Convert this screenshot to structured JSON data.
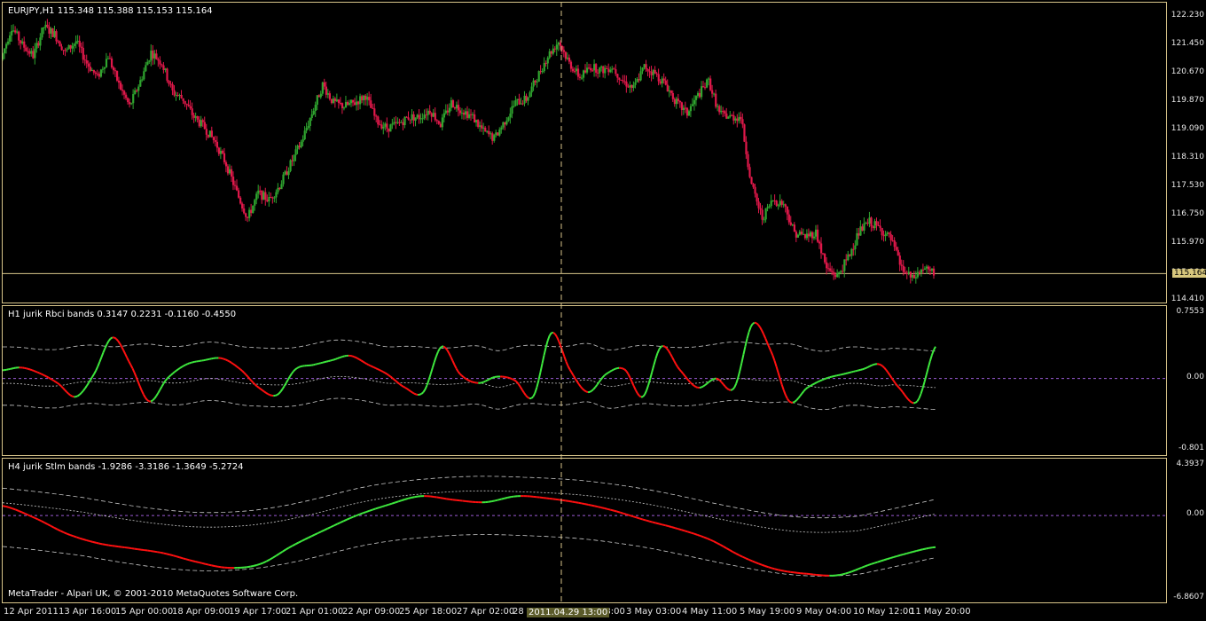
{
  "panes": {
    "main": {
      "title": "EURJPY,H1  115.348 115.388 115.153 115.164",
      "scale": [
        "122.230",
        "121.450",
        "120.670",
        "119.870",
        "119.090",
        "118.310",
        "117.530",
        "116.750",
        "115.970",
        "115.164",
        "114.410"
      ],
      "last": "115.164"
    },
    "rbci": {
      "title": "H1 jurik Rbci bands  0.3147 0.2231 -0.1160 -0.4550",
      "scale": [
        "0.7553",
        "0.00",
        "-0.801"
      ]
    },
    "stlm": {
      "title": "H4 jurik Stlm bands  -1.9286 -3.3186 -1.3649 -5.2724",
      "scale": [
        "4.3937",
        "0.00",
        "-6.8607"
      ]
    }
  },
  "credit": "MetaTrader - Alpari UK, © 2001-2010 MetaQuotes Software Corp.",
  "crosshair_label": "2011.04.29 13:00",
  "x_labels": [
    "12 Apr 2011",
    "13 Apr 16:00",
    "15 Apr 00:00",
    "18 Apr 09:00",
    "19 Apr 17:00",
    "21 Apr 01:00",
    "22 Apr 09:00",
    "25 Apr 18:00",
    "27 Apr 02:00",
    "28",
    "18:00",
    "3 May 03:00",
    "4 May 11:00",
    "5 May 19:00",
    "9 May 04:00",
    "10 May 12:00",
    "11 May 20:00"
  ],
  "colors": {
    "bull": "#2fa52f",
    "bear": "#e0184a",
    "band": "#c8c8c8",
    "zero": "#9b5bd6",
    "frame": "#d8c58a"
  },
  "chart_data": [
    {
      "type": "candlestick",
      "title": "EURJPY,H1",
      "ylim": [
        114.41,
        122.23
      ],
      "closes": [
        121.1,
        122.0,
        121.5,
        121.2,
        122.0,
        121.8,
        121.3,
        121.6,
        121.0,
        120.6,
        121.2,
        120.4,
        119.8,
        120.5,
        121.3,
        121.0,
        120.2,
        120.0,
        119.5,
        119.2,
        118.8,
        118.2,
        117.4,
        116.7,
        117.4,
        117.2,
        117.6,
        118.2,
        118.8,
        119.6,
        120.4,
        119.9,
        119.8,
        119.9,
        120.1,
        119.4,
        119.2,
        119.3,
        119.5,
        119.5,
        119.7,
        119.3,
        119.9,
        119.7,
        119.5,
        119.1,
        118.9,
        119.4,
        119.9,
        120.0,
        120.6,
        121.2,
        121.6,
        121.0,
        120.6,
        120.9,
        120.8,
        120.9,
        120.5,
        120.3,
        120.9,
        120.7,
        120.4,
        119.9,
        119.6,
        120.1,
        120.5,
        119.6,
        119.5,
        119.5,
        117.6,
        116.7,
        117.2,
        117.1,
        116.3,
        116.2,
        116.3,
        115.3,
        115.1,
        115.6,
        116.3,
        116.6,
        116.4,
        116.1,
        115.3,
        115.0,
        115.3,
        115.16
      ]
    },
    {
      "type": "line",
      "title": "H1 jurik Rbci bands",
      "ylim": [
        -0.801,
        0.7553
      ],
      "series": [
        {
          "name": "",
          "values": [
            0.09,
            0.12,
            0.06,
            -0.05,
            -0.2,
            0.05,
            0.45,
            0.15,
            -0.25,
            0.0,
            0.15,
            0.2,
            0.22,
            0.1,
            -0.1,
            -0.18,
            0.1,
            0.15,
            0.2,
            0.25,
            0.15,
            0.05,
            -0.1,
            -0.15,
            0.35,
            0.05,
            -0.05,
            0.02,
            -0.02,
            -0.2,
            0.5,
            0.1,
            -0.15,
            0.05,
            0.1,
            -0.2,
            0.35,
            0.1,
            -0.1,
            0.0,
            -0.1,
            0.6,
            0.3,
            -0.25,
            -0.1,
            0.0,
            0.05,
            0.1,
            0.15,
            -0.1,
            -0.25,
            0.35
          ]
        }
      ]
    },
    {
      "type": "line",
      "title": "H4 jurik Stlm bands",
      "ylim": [
        -6.8607,
        4.3937
      ],
      "series": [
        {
          "name": "",
          "values": [
            0.8,
            -0.2,
            -1.5,
            -2.3,
            -2.7,
            -3.1,
            -3.8,
            -4.3,
            -4.0,
            -2.5,
            -1.2,
            0.0,
            0.9,
            1.6,
            1.3,
            1.1,
            1.6,
            1.4,
            1.0,
            0.4,
            -0.4,
            -1.1,
            -2.0,
            -3.4,
            -4.4,
            -4.8,
            -4.9,
            -4.0,
            -3.2,
            -2.6
          ]
        }
      ]
    }
  ]
}
